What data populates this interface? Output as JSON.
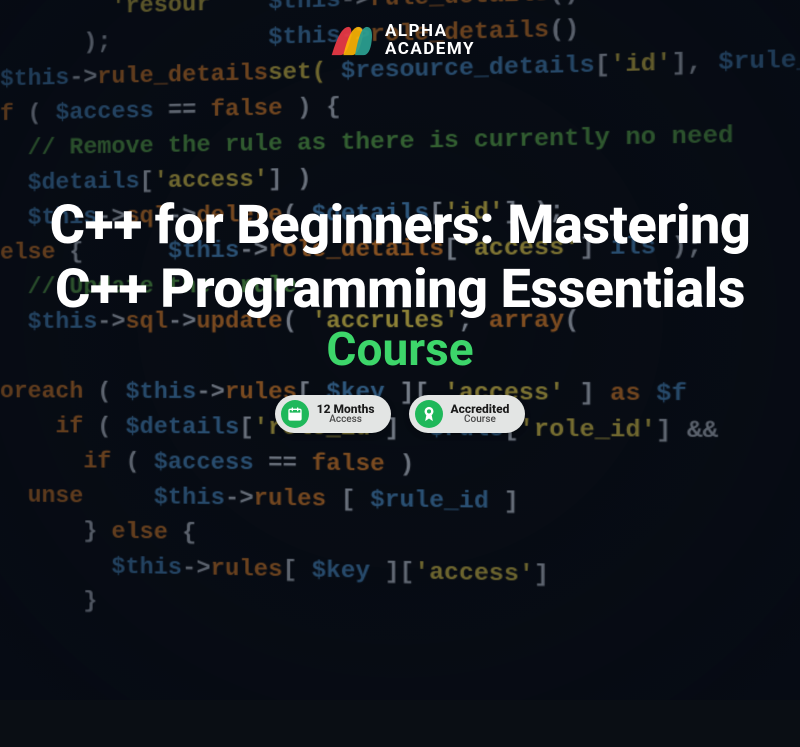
{
  "brand": {
    "line1": "ALPHA",
    "line2": "ACADEMY"
  },
  "hero": {
    "title": "C++ for Beginners: Mastering C++ Programming Essentials",
    "subtitle": "Course"
  },
  "badges": [
    {
      "line1": "12 Months",
      "line2": "Access",
      "icon": "calendar-icon"
    },
    {
      "line1": "Accredited",
      "line2": "Course",
      "icon": "ribbon-icon"
    }
  ],
  "code_lines": [
    "        'resour    $this->rule_details()",
    "      );           $this->role_details()",
    "$this->rule_detailsset( $resource_details['id'], $rule_d",
    "f ( $access == false ) {",
    "  // Remove the rule as there is currently no need",
    "  $details['access'] )",
    "  $this->sql->delete( $details['id'] );",
    "else {      $this->role_details['access'] ils );",
    "  // Update the  rule",
    "  $this->sql->update( 'accrules', array(",
    "                                         ",
    "oreach ( $this->rules[ $key ][ 'access' ] as $f",
    "    if ( $details['role_id']  $rule['role_id'] && ",
    "      if ( $access == false )",
    "  unse     $this->rules [ $rule_id ]",
    "      } else {",
    "        $this->rules[ $key ]['access'] ",
    "      }"
  ],
  "colors": {
    "accent_green": "#3dd66a",
    "badge_bg": "#e3e5e4",
    "icon_bg": "#1fb85a"
  }
}
